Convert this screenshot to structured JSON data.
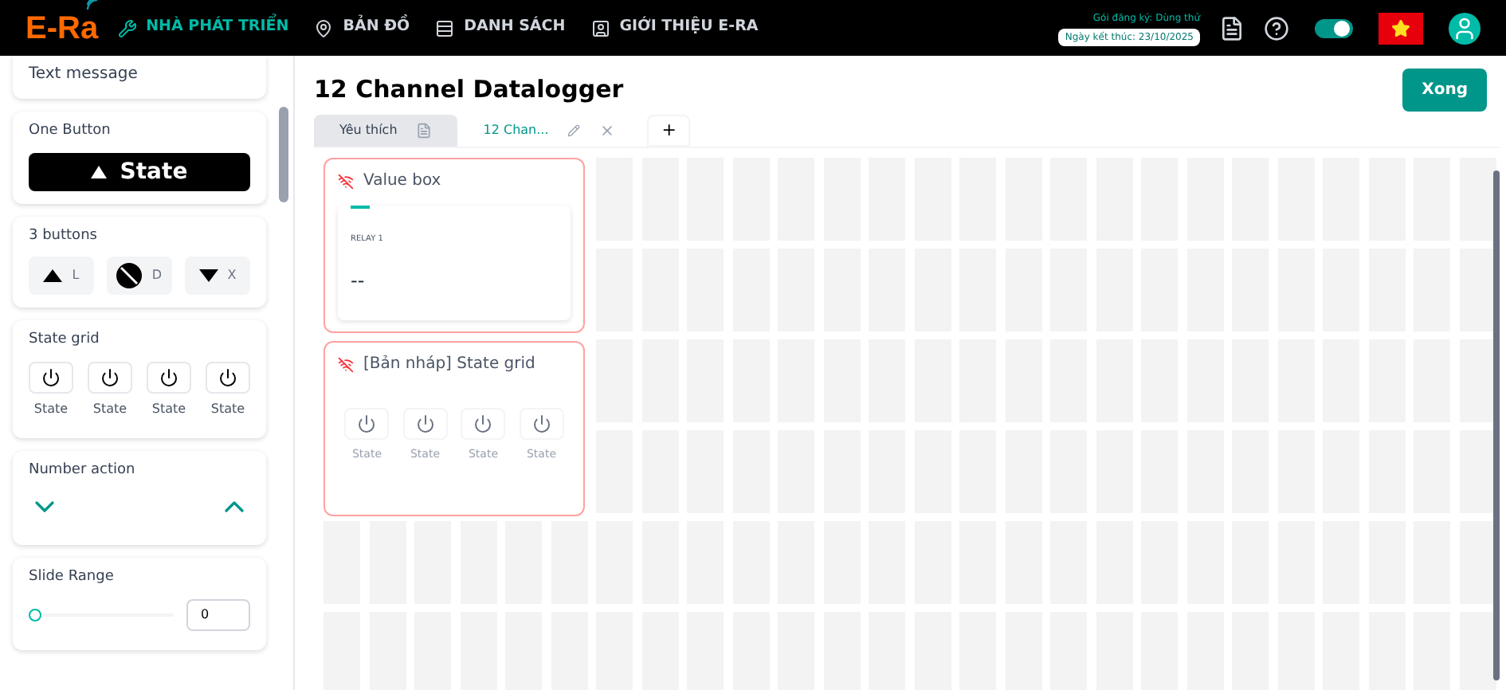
{
  "header": {
    "logo": "E-Ra",
    "nav": [
      {
        "label": "NHÀ PHÁT TRIỂN",
        "selected": true,
        "kind": "dev"
      },
      {
        "label": "BẢN ĐỒ",
        "selected": false,
        "kind": "map"
      },
      {
        "label": "DANH SÁCH",
        "selected": false,
        "kind": "list"
      },
      {
        "label": "GIỚI THIỆU E-RA",
        "selected": false,
        "kind": "about"
      }
    ],
    "plan": "Gói đăng ký: Dùng thử",
    "expiry": "Ngày kết thúc: 23/10/2025",
    "theme_toggle": {
      "on": true
    }
  },
  "sidebar": {
    "widgets": [
      {
        "kind": "text",
        "value": "Text message"
      },
      {
        "kind": "one_button",
        "title": "One Button",
        "label": "State"
      },
      {
        "kind": "three_buttons",
        "title": "3 buttons",
        "buttons": [
          "L",
          "D",
          "X"
        ]
      },
      {
        "kind": "state_grid",
        "title": "State grid",
        "labels": [
          "State",
          "State",
          "State",
          "State"
        ]
      },
      {
        "kind": "number_action",
        "title": "Number action"
      },
      {
        "kind": "slide_range",
        "title": "Slide Range",
        "value": "0",
        "level": 0
      }
    ]
  },
  "page": {
    "title": "12 Channel Datalogger",
    "done_button": "Xong",
    "tabs": [
      {
        "label": "Yêu thích",
        "selected": false
      },
      {
        "label": "12 Chan...",
        "selected": true
      }
    ],
    "add_tab": "+",
    "widgets": [
      {
        "kind": "value_box",
        "title": "Value box",
        "caption": "RELAY 1",
        "value": "--"
      },
      {
        "kind": "state_grid",
        "title": "[Bản nháp] State grid",
        "labels": [
          "State",
          "State",
          "State",
          "State"
        ]
      }
    ]
  }
}
